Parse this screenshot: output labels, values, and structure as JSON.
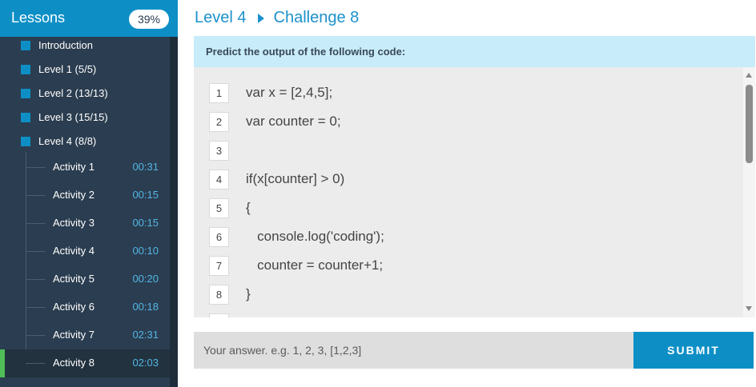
{
  "sidebar": {
    "title": "Lessons",
    "progress": "39%",
    "levels": [
      {
        "label": "Introduction"
      },
      {
        "label": "Level 1 (5/5)"
      },
      {
        "label": "Level 2 (13/13)"
      },
      {
        "label": "Level 3 (15/15)"
      },
      {
        "label": "Level 4 (8/8)"
      }
    ],
    "activities": [
      {
        "name": "Activity 1",
        "time": "00:31"
      },
      {
        "name": "Activity 2",
        "time": "00:15"
      },
      {
        "name": "Activity 3",
        "time": "00:15"
      },
      {
        "name": "Activity 4",
        "time": "00:10"
      },
      {
        "name": "Activity 5",
        "time": "00:20"
      },
      {
        "name": "Activity 6",
        "time": "00:18"
      },
      {
        "name": "Activity 7",
        "time": "02:31"
      },
      {
        "name": "Activity 8",
        "time": "02:03"
      }
    ]
  },
  "header": {
    "level": "Level 4",
    "challenge": "Challenge 8"
  },
  "prompt": "Predict the output of the following code:",
  "code": {
    "lines": [
      {
        "num": "1",
        "text": "var x = [2,4,5];"
      },
      {
        "num": "2",
        "text": "var counter = 0;"
      },
      {
        "num": "3",
        "text": ""
      },
      {
        "num": "4",
        "text": "if(x[counter] > 0)"
      },
      {
        "num": "5",
        "text": "{"
      },
      {
        "num": "6",
        "text": "   console.log('coding');"
      },
      {
        "num": "7",
        "text": "   counter = counter+1;"
      },
      {
        "num": "8",
        "text": "}"
      }
    ]
  },
  "answer": {
    "placeholder": "Your answer. e.g. 1, 2, 3, [1,2,3]",
    "value": ""
  },
  "submit_label": "SUBMIT",
  "colors": {
    "accent": "#0d8fc6",
    "sidebar_bg": "#2b3d50",
    "active_marker": "#4fbd58",
    "time_text": "#52b7e6",
    "prompt_bg": "#c8ecf9"
  }
}
